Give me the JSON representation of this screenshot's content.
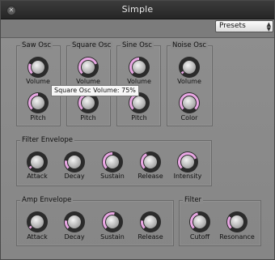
{
  "window": {
    "title": "Simple"
  },
  "toolbar": {
    "presets_label": "Presets"
  },
  "colors": {
    "accent": "#e9a7e4",
    "track": "#2b2b2b"
  },
  "tooltip": {
    "text": "Square Osc Volume: 75%"
  },
  "groups": {
    "saw": {
      "title": "Saw Osc",
      "volume": "Volume",
      "pitch": "Pitch"
    },
    "square": {
      "title": "Square Osc",
      "volume": "Volume",
      "pitch": "Pitch"
    },
    "sine": {
      "title": "Sine Osc",
      "volume": "Volume",
      "pitch": "Pitch"
    },
    "noise": {
      "title": "Noise Osc",
      "volume": "Volume",
      "color": "Color"
    },
    "filter_env": {
      "title": "Filter Envelope",
      "attack": "Attack",
      "decay": "Decay",
      "sustain": "Sustain",
      "release": "Release",
      "intensity": "Intensity"
    },
    "amp_env": {
      "title": "Amp Envelope",
      "attack": "Attack",
      "decay": "Decay",
      "sustain": "Sustain",
      "release": "Release"
    },
    "filter": {
      "title": "Filter",
      "cutoff": "Cutoff",
      "resonance": "Resonance"
    }
  },
  "knob_levels": {
    "saw_volume": 0.25,
    "saw_pitch": 0.5,
    "square_volume": 0.75,
    "square_pitch": 0.5,
    "sine_volume": 0.5,
    "sine_pitch": 0.5,
    "noise_volume": 0.05,
    "noise_color": 1.0,
    "fenv_attack": 0.05,
    "fenv_decay": 0.2,
    "fenv_sustain": 0.5,
    "fenv_release": 0.4,
    "fenv_intensity": 0.75,
    "aenv_attack": 0.05,
    "aenv_decay": 0.2,
    "aenv_sustain": 0.55,
    "aenv_release": 0.2,
    "filter_cutoff": 0.45,
    "filter_resonance": 0.3
  }
}
